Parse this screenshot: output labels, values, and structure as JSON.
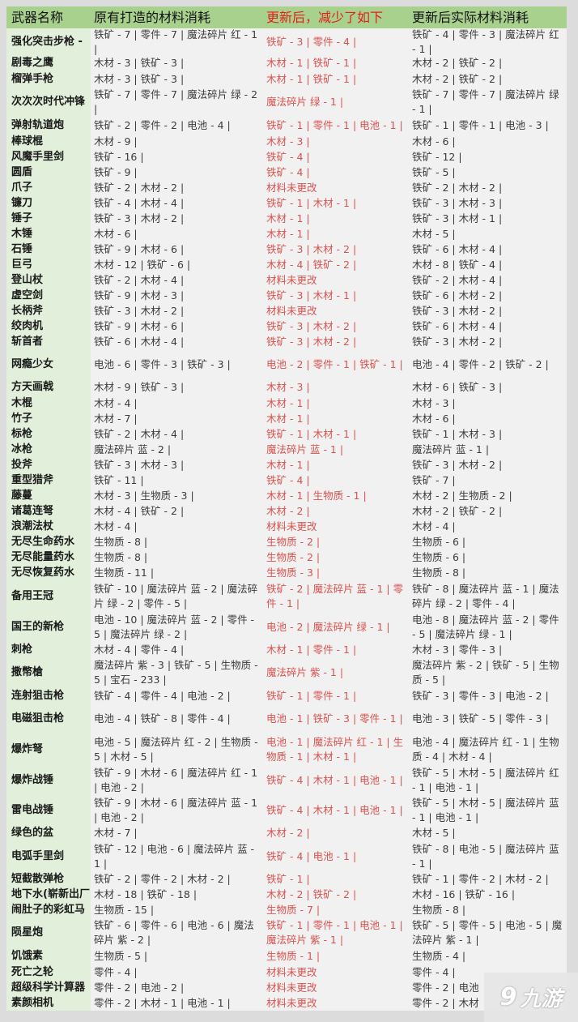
{
  "header": {
    "name": "武器名称",
    "original": "原有打造的材料消耗",
    "reduced": "更新后，减少了如下",
    "actual": "更新后实际材料消耗"
  },
  "rows": [
    {
      "name": "强化突击步枪 - ",
      "original": "铁矿 - 7 | 零件 - 7 | 魔法碎片 红 - 1 |",
      "reduced": "铁矿 - 3 | 零件 - 4 |",
      "actual": "铁矿 - 4  | 零件 - 3  | 魔法碎片 红 - 1  |"
    },
    {
      "name": "剧毒之鹰",
      "original": "木材 - 3 | 铁矿 - 3 |",
      "reduced": "木材 - 1 | 铁矿 - 1 |",
      "actual": "木材 - 2  | 铁矿 - 2  |"
    },
    {
      "name": "榴弹手枪",
      "original": "木材 - 3 | 铁矿 - 3 |",
      "reduced": "木材 - 1 | 铁矿 - 1 |",
      "actual": "木材 - 2  | 铁矿 - 2  |"
    },
    {
      "name": "次次次时代冲锋",
      "original": "铁矿 - 7 | 零件 - 7 | 魔法碎片 绿 - 2 |",
      "reduced": "魔法碎片 绿 - 1 |",
      "actual": "铁矿 - 7  | 零件 - 7  | 魔法碎片 绿 - 1  |"
    },
    {
      "name": "弹射轨道炮",
      "original": "铁矿 - 2 | 零件 - 2 | 电池 - 4 |",
      "reduced": "铁矿 - 1 | 零件 - 1 | 电池 - 1 |",
      "actual": "铁矿 - 1  | 零件 - 1  | 电池 - 3  |"
    },
    {
      "name": "棒球棍",
      "original": "木材 - 9 |",
      "reduced": "木材 - 3 |",
      "actual": "木材 - 6  |"
    },
    {
      "name": "风魔手里剑",
      "original": "铁矿 - 16 |",
      "reduced": "铁矿 - 4 |",
      "actual": "铁矿 - 12  |"
    },
    {
      "name": "圆盾",
      "original": "铁矿 - 9 |",
      "reduced": "铁矿 - 4 |",
      "actual": "铁矿 - 5  |"
    },
    {
      "name": "爪子",
      "original": "铁矿 - 2 | 木材 - 2 |",
      "reduced": "材料未更改",
      "actual": "铁矿 - 2  | 木材 - 2  |"
    },
    {
      "name": "镰刀",
      "original": "铁矿 - 4 | 木材 - 4 |",
      "reduced": "铁矿 - 1 | 木材 - 1 |",
      "actual": "铁矿 - 3  | 木材 - 3  |"
    },
    {
      "name": "锤子",
      "original": "铁矿 - 3 | 木材 - 2 |",
      "reduced": "木材 - 1 |",
      "actual": "铁矿 - 3  | 木材 - 1  |"
    },
    {
      "name": "木锤",
      "original": "木材 - 6 |",
      "reduced": "木材 - 1 |",
      "actual": "木材 - 5  |"
    },
    {
      "name": "石锤",
      "original": "铁矿 - 9 | 木材 - 6 |",
      "reduced": "铁矿 - 3 | 木材 - 2 |",
      "actual": "铁矿 - 6  | 木材 - 4  |"
    },
    {
      "name": "巨弓",
      "original": "木材 - 12 | 铁矿 - 6 |",
      "reduced": "木材 - 4 | 铁矿 - 2 |",
      "actual": "木材 - 8  | 铁矿 - 4  |"
    },
    {
      "name": "登山杖",
      "original": "铁矿 - 2 | 木材 - 4 |",
      "reduced": "材料未更改",
      "actual": "铁矿 - 2  | 木材 - 4  |"
    },
    {
      "name": "虚空剑",
      "original": "铁矿 - 9 | 木材 - 3 |",
      "reduced": "铁矿 - 3 | 木材 - 1 |",
      "actual": "铁矿 - 6  | 木材 - 2  |"
    },
    {
      "name": "长柄斧",
      "original": "铁矿 - 3 | 木材 - 2 |",
      "reduced": "材料未更改",
      "actual": "铁矿 - 3  | 木材 - 2  |"
    },
    {
      "name": "绞肉机",
      "original": "铁矿 - 9 | 木材 - 6 |",
      "reduced": "铁矿 - 3 | 木材 - 2 |",
      "actual": "铁矿 - 6  | 木材 - 4  |"
    },
    {
      "name": "斩首者",
      "original": "铁矿 - 6 | 木材 - 4 |",
      "reduced": "铁矿 - 3 | 木材 - 2 |",
      "actual": "铁矿 - 3  | 木材 - 2  |"
    },
    {
      "name": "网瘾少女",
      "original": "电池 - 6 | 零件 - 3 | 铁矿 - 3 |",
      "reduced": "电池 - 2 | 零件 - 1 | 铁矿 - 1 |",
      "actual": "电池 - 4  | 零件 - 2  | 铁矿 - 2  |"
    },
    {
      "name": "方天画戟",
      "original": "木材 - 9 | 铁矿 - 3 |",
      "reduced": "木材 - 3 |",
      "actual": "木材 - 6  | 铁矿 - 3  |"
    },
    {
      "name": "木棍",
      "original": "木材 - 4 |",
      "reduced": "木材 - 1 |",
      "actual": "木材 - 3  |"
    },
    {
      "name": "竹子",
      "original": "木材 - 7 |",
      "reduced": "木材 - 1 |",
      "actual": "木材 - 6  |"
    },
    {
      "name": "标枪",
      "original": "铁矿 - 2 | 木材 - 4 |",
      "reduced": "铁矿 - 1 | 木材 - 1 |",
      "actual": "铁矿 - 1  | 木材 - 3  |"
    },
    {
      "name": "冰枪",
      "original": "魔法碎片 蓝 - 2 |",
      "reduced": "魔法碎片 蓝 - 1 |",
      "actual": "魔法碎片 蓝 - 1  |"
    },
    {
      "name": "投斧",
      "original": "铁矿 - 3 | 木材 - 3 |",
      "reduced": "木材 - 1 |",
      "actual": "铁矿 - 3  | 木材 - 2  |"
    },
    {
      "name": "重型猎斧",
      "original": "铁矿 - 11 |",
      "reduced": "铁矿 - 4 |",
      "actual": "铁矿 - 7  |"
    },
    {
      "name": "藤蔓",
      "original": "木材 - 3 | 生物质 - 3 |",
      "reduced": "木材 - 1 | 生物质 - 1 |",
      "actual": "木材 - 2  | 生物质 - 2  |"
    },
    {
      "name": "诸葛连弩",
      "original": "木材 - 4 | 铁矿 - 2 |",
      "reduced": "木材 - 2 |",
      "actual": "木材 - 2  | 铁矿 - 2  |"
    },
    {
      "name": "浪潮法杖",
      "original": "木材 - 4 |",
      "reduced": "材料未更改",
      "actual": "木材 - 4  |"
    },
    {
      "name": "无尽生命药水",
      "original": "生物质 - 8 |",
      "reduced": "生物质 - 2 |",
      "actual": "生物质 - 6  |"
    },
    {
      "name": "无尽能量药水",
      "original": "生物质 - 8 |",
      "reduced": "生物质 - 2 |",
      "actual": "生物质 - 6  |"
    },
    {
      "name": "无尽恢复药水",
      "original": "生物质 - 11 |",
      "reduced": "生物质 - 3 |",
      "actual": "生物质 - 8  |"
    },
    {
      "name": "备用王冠",
      "original": "铁矿 - 10 | 魔法碎片 蓝 - 2 | 魔法碎片 绿 - 2 | 零件 - 5 |",
      "reduced": "铁矿 - 2 | 魔法碎片 蓝 - 1 | 零件 - 1 |",
      "actual": "铁矿 - 8  | 魔法碎片 蓝 - 1  | 魔法碎片 绿 - 2  | 零件 - 4  |"
    },
    {
      "name": "国王的新枪",
      "original": "电池 - 10 | 魔法碎片 蓝 - 2 | 零件 - 5 | 魔法碎片 绿 - 2 |",
      "reduced": "电池 - 2 | 魔法碎片 绿 - 1 |",
      "actual": "电池 - 8  | 魔法碎片 蓝 - 2  | 零件 - 5  | 魔法碎片 绿 - 1  |"
    },
    {
      "name": "刺枪",
      "original": "木材 - 4 | 零件 - 4 |",
      "reduced": "木材 - 1 | 零件 - 1 |",
      "actual": "木材 - 3  | 零件 - 3  |"
    },
    {
      "name": "撒幣槍",
      "original": "魔法碎片 紫 - 3 | 铁矿 - 5 | 生物质 - 5 | 宝石 - 233 |",
      "reduced": "魔法碎片 紫 - 1 |",
      "actual": "魔法碎片 紫 - 2  | 铁矿 - 5  | 生物质 - 5  |"
    },
    {
      "name": "连射狙击枪",
      "original": "铁矿 - 4 | 零件 - 4 | 电池 - 2 |",
      "reduced": "铁矿 - 1 | 零件 - 1 |",
      "actual": "铁矿 - 3  | 零件 - 3  | 电池 - 2  |"
    },
    {
      "name": "电磁狙击枪",
      "original": "电池 - 4 | 铁矿 - 8 | 零件 - 4 |",
      "reduced": "电池 - 1 | 铁矿 - 3 | 零件 - 1 |",
      "actual": "电池 - 3  | 铁矿 - 5  | 零件 - 3  |"
    },
    {
      "name": "爆炸弩",
      "original": "电池 - 5 | 魔法碎片 红 - 2 | 生物质 - 5 | 木材 - 5 |",
      "reduced": "电池 - 1 | 魔法碎片 红 - 1 | 生物质 - 1 | 木材 - 1 |",
      "actual": "电池 - 4  | 魔法碎片 红 - 1  | 生物质 - 4  | 木材 - 4  |"
    },
    {
      "name": "爆炸战锤",
      "original": "铁矿 - 9 | 木材 - 6 | 魔法碎片 红 - 1 | 电池 - 2 |",
      "reduced": "铁矿 - 4 | 木材 - 1 | 电池 - 1 |",
      "actual": "铁矿 - 5  | 木材 - 5  | 魔法碎片 红 - 1  | 电池 - 1  |"
    },
    {
      "name": "雷电战锤",
      "original": "铁矿 - 9 | 木材 - 6 | 魔法碎片 蓝 - 1 | 电池 - 2 |",
      "reduced": "铁矿 - 4 | 木材 - 1 | 电池 - 1 |",
      "actual": "铁矿 - 5  | 木材 - 5  | 魔法碎片 蓝 - 1  | 电池 - 1  |"
    },
    {
      "name": "绿色的盆",
      "original": "木材 - 7 |",
      "reduced": "木材 - 2 |",
      "actual": "木材 - 5  |"
    },
    {
      "name": "电弧手里剑",
      "original": "铁矿 - 12 | 电池 - 6 | 魔法碎片 蓝 - 1 |",
      "reduced": "铁矿 - 4 | 电池 - 1 |",
      "actual": "铁矿 - 8  | 电池 - 5  | 魔法碎片 蓝 - 1  |"
    },
    {
      "name": "短截散弹枪",
      "original": "铁矿 - 2 | 零件 - 2 | 木材 - 2 |",
      "reduced": "铁矿 - 1 |",
      "actual": "铁矿 - 1  | 零件 - 2  | 木材 - 2  |"
    },
    {
      "name": "地下水(崭新出厂",
      "original": "木材 - 18 | 铁矿 - 18 |",
      "reduced": "木材 - 2 | 铁矿 - 2 |",
      "actual": "木材 - 16  | 铁矿 - 16  |"
    },
    {
      "name": "闹肚子的彩虹马",
      "original": "生物质 - 15 |",
      "reduced": "生物质 - 7 |",
      "actual": "生物质 - 8  |"
    },
    {
      "name": "陨星炮",
      "original": "铁矿 - 6 | 零件 - 6 | 电池 - 6 | 魔法碎片 紫 - 2 |",
      "reduced": "铁矿 - 1 | 零件 - 1 | 电池 - 1 | 魔法碎片 紫 - 1 |",
      "actual": "铁矿 - 5  | 零件 - 5  | 电池 - 5  | 魔法碎片 紫 - 1  |"
    },
    {
      "name": "饥饿素",
      "original": "生物质 - 5 |",
      "reduced": "生物质 - 1 |",
      "actual": "生物质 - 4  |"
    },
    {
      "name": "死亡之轮",
      "original": "零件 - 4 |",
      "reduced": "材料未更改",
      "actual": "零件 - 4  |"
    },
    {
      "name": "超级科学计算器",
      "original": "零件 - 2 | 电池 - 2 |",
      "reduced": "材料未更改",
      "actual": "零件 - 2  | 电池"
    },
    {
      "name": "素颜相机",
      "original": "零件 - 2 | 木材 - 1 | 电池 - 1 |",
      "reduced": "材料未更改",
      "actual": "零件 - 2  | 木材"
    }
  ],
  "watermark": {
    "logo": "9",
    "text": "九游"
  },
  "colors": {
    "header_bg": "#a9d18e",
    "name_col_bg": "#e2efda",
    "cell_bg": "#f1f1f1",
    "reduced_text": "#d9534f",
    "header_reduced_text": "#e0201a"
  }
}
